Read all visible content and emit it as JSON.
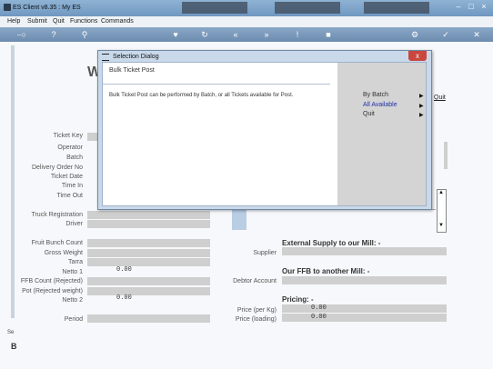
{
  "titlebar": {
    "app_title": "ES Client v8.35 : My ES"
  },
  "menu": [
    "Help",
    "Submit",
    "Quit",
    "Functions",
    "Commands"
  ],
  "form": {
    "title_partial": "W",
    "quit_link": "Quit",
    "labels": {
      "ticket_key": "Ticket Key",
      "operator": "Operator",
      "batch": "Batch",
      "delivery_order_no": "Delivery Order No",
      "ticket_date": "Ticket Date",
      "time_in": "Time In",
      "time_out": "Time Out",
      "truck_registration": "Truck Registration",
      "driver": "Driver",
      "fruit_bunch_count": "Fruit Bunch Count",
      "gross_weight": "Gross Weight",
      "tarra": "Tarra",
      "netto_1": "Netto 1",
      "ffb_count_rejected": "FFB Count (Rejected)",
      "pot_rejected_weight": "Pot (Rejected weight)",
      "netto_2": "Netto 2",
      "period": "Period",
      "supplier": "Supplier",
      "debtor_account": "Debtor Account",
      "price_per_kg": "Price (per Kg)",
      "price_loading": "Price (loading)"
    },
    "values": {
      "netto_1": "0.00",
      "netto_2": "0.00",
      "price_per_kg": "0.00",
      "price_loading": "0.00"
    },
    "sections": {
      "external_supply": "External Supply to our Mill: -",
      "ffb_to_mill": "Our FFB to another Mill: -",
      "pricing": "Pricing: -"
    },
    "status_partial": "Se"
  },
  "dialog": {
    "title": "Selection Dialog",
    "heading": "Bulk Ticket Post",
    "description": "Bulk Ticket Post can be performed by Batch, or all Tickets available for Post.",
    "options": [
      {
        "label": "By Batch",
        "color": "#333333"
      },
      {
        "label": "All Available",
        "color": "#1f2fa8"
      },
      {
        "label": "Quit",
        "color": "#333333"
      }
    ],
    "close_symbol": "x"
  },
  "icons": [
    "key-icon",
    "help-icon",
    "search-icon",
    "favorite-icon",
    "refresh-icon",
    "back-icon",
    "forward-icon",
    "info-icon",
    "stop-icon",
    "settings-icon",
    "confirm-icon",
    "cancel-icon"
  ],
  "colors": {
    "titlebar": "#7fa3c8",
    "close_button": "#c9473f",
    "field": "#cfcfcf",
    "highlight": "#1f2fa8"
  }
}
